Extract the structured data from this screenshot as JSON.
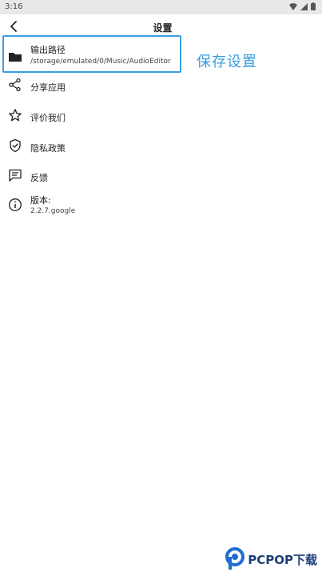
{
  "status_bar": {
    "time": "3:16"
  },
  "header": {
    "title": "设置"
  },
  "settings": {
    "output_path": {
      "label": "输出路径",
      "value": "/storage/emulated/0/Music/AudioEditor"
    },
    "share": {
      "label": "分享应用"
    },
    "rate": {
      "label": "评价我们"
    },
    "privacy": {
      "label": "隐私政策"
    },
    "feedback": {
      "label": "反馈"
    },
    "version": {
      "label": "版本:",
      "value": "2.2.7.google"
    }
  },
  "annotation": {
    "text": "保存设置",
    "color": "#3a9de0"
  },
  "watermark": {
    "text": "PCPOP下载"
  }
}
